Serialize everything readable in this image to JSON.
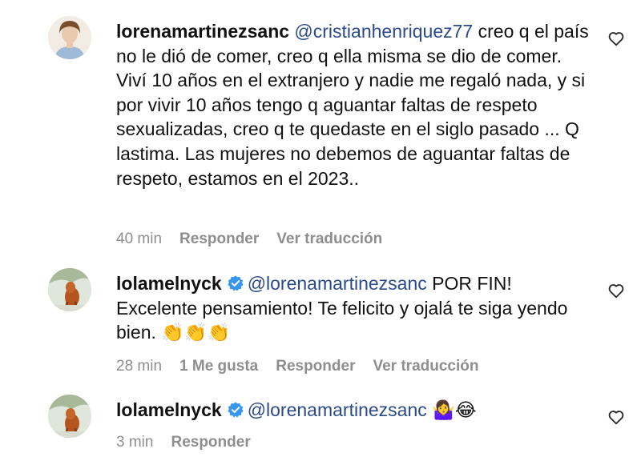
{
  "comments": [
    {
      "username": "lorenamartinezsanc",
      "verified": false,
      "mention": "@cristianhenriquez77",
      "text": " creo q el país no le dió de comer, creo q ella misma se dio de comer. Viví 10 años en el extranjero y nadie me regaló nada, y si por vivir 10 años tengo q aguantar faltas de respeto sexualizadas, creo q te quedaste en el siglo pasado ... Q lastima. Las mujeres no debemos de aguantar faltas de respeto, estamos en el 2023..",
      "time": "40 min",
      "likes": "",
      "reply_label": "Responder",
      "translate_label": "Ver traducción",
      "avatar_icon": "profile-photo-woman"
    },
    {
      "username": "lolamelnyck",
      "verified": true,
      "mention": "@lorenamartinezsanc",
      "text": " POR FIN! Excelente pensamiento! Te felicito y ojalá te siga yendo bien. 👏👏👏",
      "time": "28 min",
      "likes": "1 Me gusta",
      "reply_label": "Responder",
      "translate_label": "Ver traducción",
      "avatar_icon": "profile-photo-dog"
    },
    {
      "username": "lolamelnyck",
      "verified": true,
      "mention": "@lorenamartinezsanc",
      "text": " 🤷‍♀️😂",
      "time": "3 min",
      "likes": "",
      "reply_label": "Responder",
      "translate_label": "",
      "avatar_icon": "profile-photo-dog"
    }
  ],
  "colors": {
    "mention": "#2a4a8a",
    "meta": "#8e8e8e",
    "verified": "#3797f0"
  }
}
